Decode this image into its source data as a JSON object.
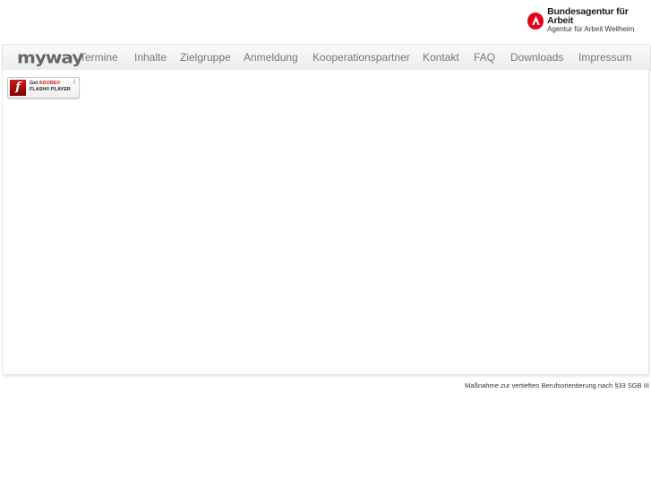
{
  "header": {
    "org_logo": {
      "icon": "bundesagentur-logo-icon",
      "title": "Bundesagentur für Arbeit",
      "subtitle": "Agentur für Arbeit Weilheim",
      "brand_color": "#e2001a"
    }
  },
  "nav": {
    "logo_text": "myway",
    "items": [
      {
        "label": "Termine"
      },
      {
        "label": "Inhalte"
      },
      {
        "label": "Zielgruppe"
      },
      {
        "label": "Anmeldung"
      },
      {
        "label": "Kooperationspartner"
      },
      {
        "label": "Kontakt"
      },
      {
        "label": "FAQ"
      },
      {
        "label": "Downloads"
      },
      {
        "label": "Impressum"
      }
    ]
  },
  "content": {
    "flash_badge": {
      "icon": "flash-player-icon",
      "line1_prefix": "Get ",
      "line1_brand": "ADOBE®",
      "line2": "FLASH® PLAYER",
      "download_glyph": "⇩"
    }
  },
  "footer": {
    "note": "Maßnahme zur vertieften Berufsorientierung nach §33 SGB III"
  }
}
